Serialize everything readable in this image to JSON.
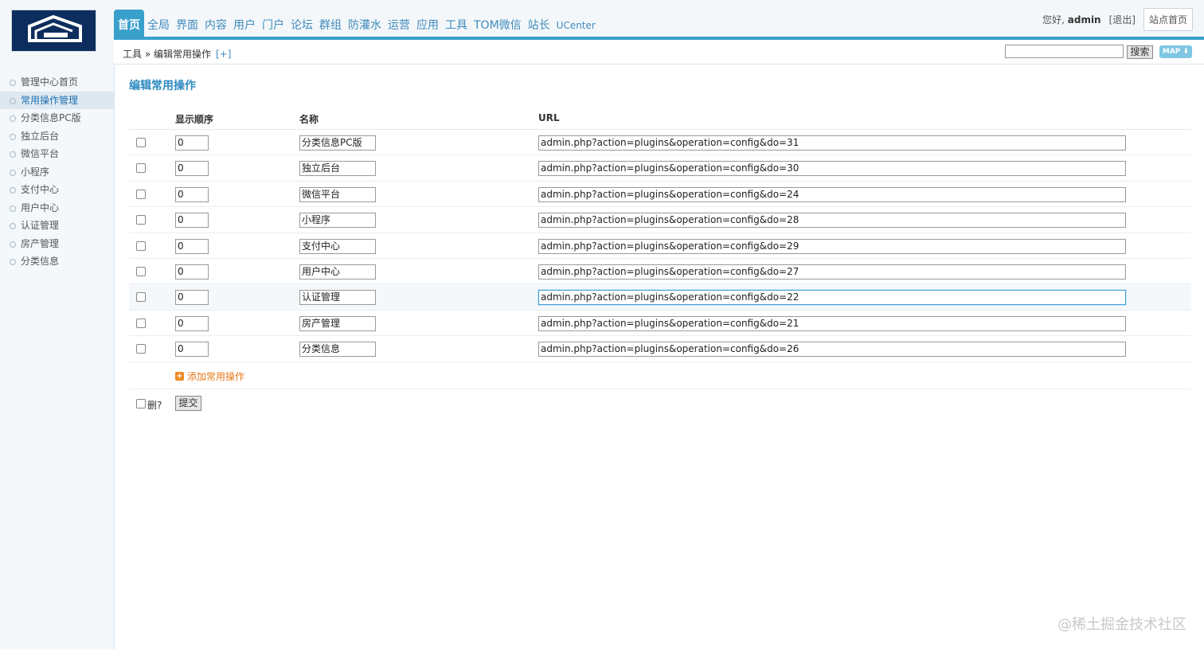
{
  "header": {
    "nav": [
      {
        "label": "首页",
        "active": true
      },
      {
        "label": "全局"
      },
      {
        "label": "界面"
      },
      {
        "label": "内容"
      },
      {
        "label": "用户"
      },
      {
        "label": "门户"
      },
      {
        "label": "论坛"
      },
      {
        "label": "群组"
      },
      {
        "label": "防灌水"
      },
      {
        "label": "运营"
      },
      {
        "label": "应用"
      },
      {
        "label": "工具"
      },
      {
        "label": "TOM微信"
      },
      {
        "label": "站长"
      },
      {
        "label": "UCenter"
      }
    ],
    "greeting_prefix": "您好,",
    "username": "admin",
    "logout_label": "[退出]",
    "site_home_label": "站点首页"
  },
  "breadcrumb": {
    "path": "工具 » 编辑常用操作",
    "plus": "[+]"
  },
  "search": {
    "value": "",
    "button_label": "搜索",
    "map_label": "MAP ⬇"
  },
  "sidebar": {
    "items": [
      {
        "label": "管理中心首页"
      },
      {
        "label": "常用操作管理",
        "active": true
      },
      {
        "label": "分类信息PC版"
      },
      {
        "label": "独立后台"
      },
      {
        "label": "微信平台"
      },
      {
        "label": "小程序"
      },
      {
        "label": "支付中心"
      },
      {
        "label": "用户中心"
      },
      {
        "label": "认证管理"
      },
      {
        "label": "房产管理"
      },
      {
        "label": "分类信息"
      }
    ]
  },
  "main": {
    "title": "编辑常用操作",
    "columns": {
      "order": "显示顺序",
      "name": "名称",
      "url": "URL"
    },
    "rows": [
      {
        "order": "0",
        "name": "分类信息PC版",
        "url": "admin.php?action=plugins&operation=config&do=31"
      },
      {
        "order": "0",
        "name": "独立后台",
        "url": "admin.php?action=plugins&operation=config&do=30"
      },
      {
        "order": "0",
        "name": "微信平台",
        "url": "admin.php?action=plugins&operation=config&do=24"
      },
      {
        "order": "0",
        "name": "小程序",
        "url": "admin.php?action=plugins&operation=config&do=28"
      },
      {
        "order": "0",
        "name": "支付中心",
        "url": "admin.php?action=plugins&operation=config&do=29"
      },
      {
        "order": "0",
        "name": "用户中心",
        "url": "admin.php?action=plugins&operation=config&do=27"
      },
      {
        "order": "0",
        "name": "认证管理",
        "url": "admin.php?action=plugins&operation=config&do=22",
        "focused": true
      },
      {
        "order": "0",
        "name": "房产管理",
        "url": "admin.php?action=plugins&operation=config&do=21"
      },
      {
        "order": "0",
        "name": "分类信息",
        "url": "admin.php?action=plugins&operation=config&do=26"
      }
    ],
    "add_label": "添加常用操作",
    "delete_label": "删?",
    "submit_label": "提交"
  },
  "watermark": "@稀土掘金技术社区",
  "colors": {
    "accent": "#39a0cc",
    "link": "#3f8bbb",
    "title": "#2e8bc0",
    "add": "#e8791a"
  }
}
